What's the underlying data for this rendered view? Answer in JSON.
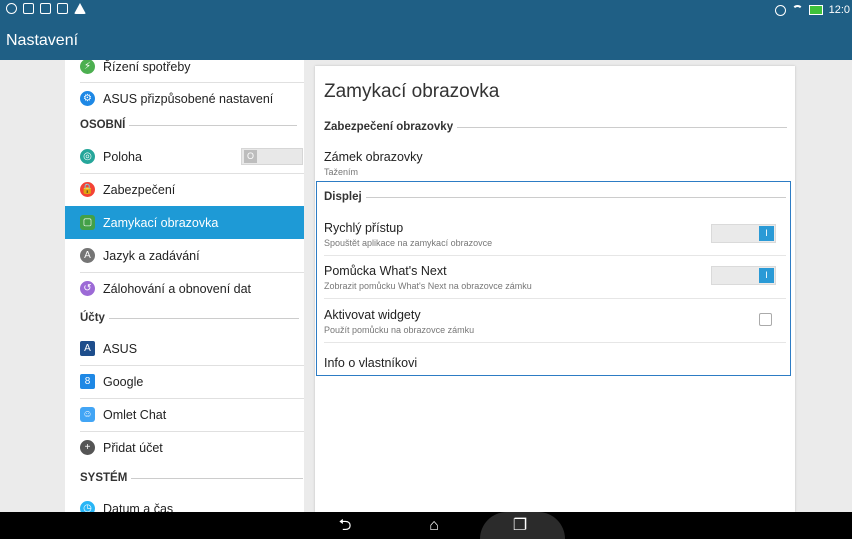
{
  "statusbar": {
    "time": "12:0"
  },
  "actionbar": {
    "title": "Nastavení"
  },
  "left_panel": {
    "items": [
      {
        "label": "Řízení spotřeby",
        "color": "#4caf50",
        "glyph": "⚡"
      },
      {
        "label": "ASUS přizpůsobené nastavení",
        "color": "#1e88e5",
        "glyph": "⚙"
      },
      {
        "section": "OSOBNÍ"
      },
      {
        "label": "Poloha",
        "color": "#26a69a",
        "glyph": "◎",
        "toggle": "O"
      },
      {
        "label": "Zabezpečení",
        "color": "#f44336",
        "glyph": "🔒"
      },
      {
        "label": "Zamykací obrazovka",
        "color": "#43a047",
        "glyph": "▢",
        "selected": true
      },
      {
        "label": "Jazyk a zadávání",
        "color": "#757575",
        "glyph": "A"
      },
      {
        "label": "Zálohování a obnovení dat",
        "color": "#9c6ad6",
        "glyph": "↺"
      },
      {
        "section": "Účty"
      },
      {
        "label": "ASUS",
        "color": "#1e4e8c",
        "glyph": "A"
      },
      {
        "label": "Google",
        "color": "#1e88e5",
        "glyph": "8"
      },
      {
        "label": "Omlet Chat",
        "color": "#42a5f5",
        "glyph": "☺"
      },
      {
        "label": "Přidat účet",
        "color": "#555555",
        "glyph": "+"
      },
      {
        "section": "SYSTÉM"
      },
      {
        "label": "Datum a čas",
        "color": "#29b6f6",
        "glyph": "◷"
      }
    ]
  },
  "right_panel": {
    "title": "Zamykací obrazovka",
    "security_section": "Zabezpečení obrazovky",
    "screen_lock": {
      "title": "Zámek obrazovky",
      "sub": "Tažením"
    },
    "display_section": "Displej",
    "quick_access": {
      "title": "Rychlý přístup",
      "sub": "Spouštět aplikace na zamykací obrazovce",
      "toggle": "I"
    },
    "whats_next": {
      "title": "Pomůcka What's Next",
      "sub": "Zobrazit pomůcku What's Next na obrazovce zámku",
      "toggle": "I"
    },
    "widgets": {
      "title": "Aktivovat widgety",
      "sub": "Použít pomůcku na obrazovce zámku"
    },
    "owner_info": {
      "title": "Info o vlastníkovi"
    }
  },
  "navbar": {
    "back": "⮌",
    "home": "⌂",
    "recents": "❐"
  }
}
